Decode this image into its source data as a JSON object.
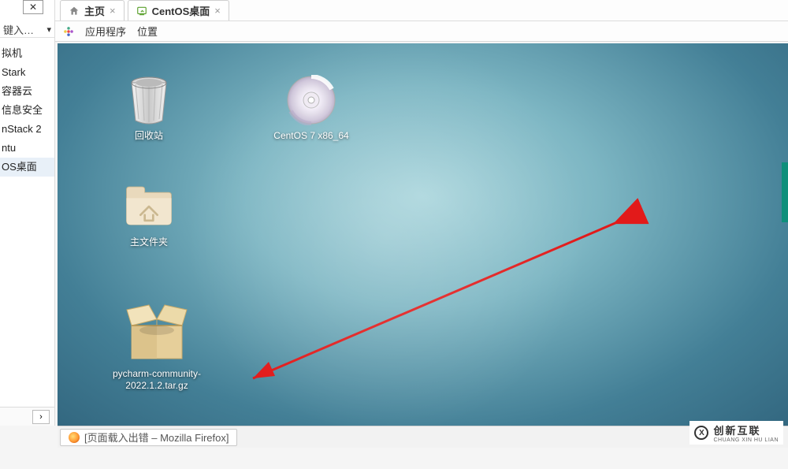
{
  "left_panel": {
    "filter_text": "键入…",
    "vm_items": [
      "拟机",
      " Stark",
      "容器云",
      "信息安全",
      "nStack 2",
      "ntu",
      "OS桌面"
    ]
  },
  "tabs": [
    {
      "label": "主页",
      "icon": "home"
    },
    {
      "label": "CentOS桌面",
      "icon": "vm"
    }
  ],
  "gnome_menu": {
    "apps": "应用程序",
    "places": "位置"
  },
  "desktop_icons": {
    "trash": "回收站",
    "disc": "CentOS 7 x86_64",
    "home": "主文件夹",
    "package": "pycharm-community-\n2022.1.2.tar.gz"
  },
  "taskbar": {
    "firefox_title": "[页面载入出错 – Mozilla Firefox]"
  },
  "watermark": {
    "zh": "创新互联",
    "py": "CHUANG XIN HU LIAN"
  },
  "colors": {
    "arrow": "#e21a1a"
  }
}
